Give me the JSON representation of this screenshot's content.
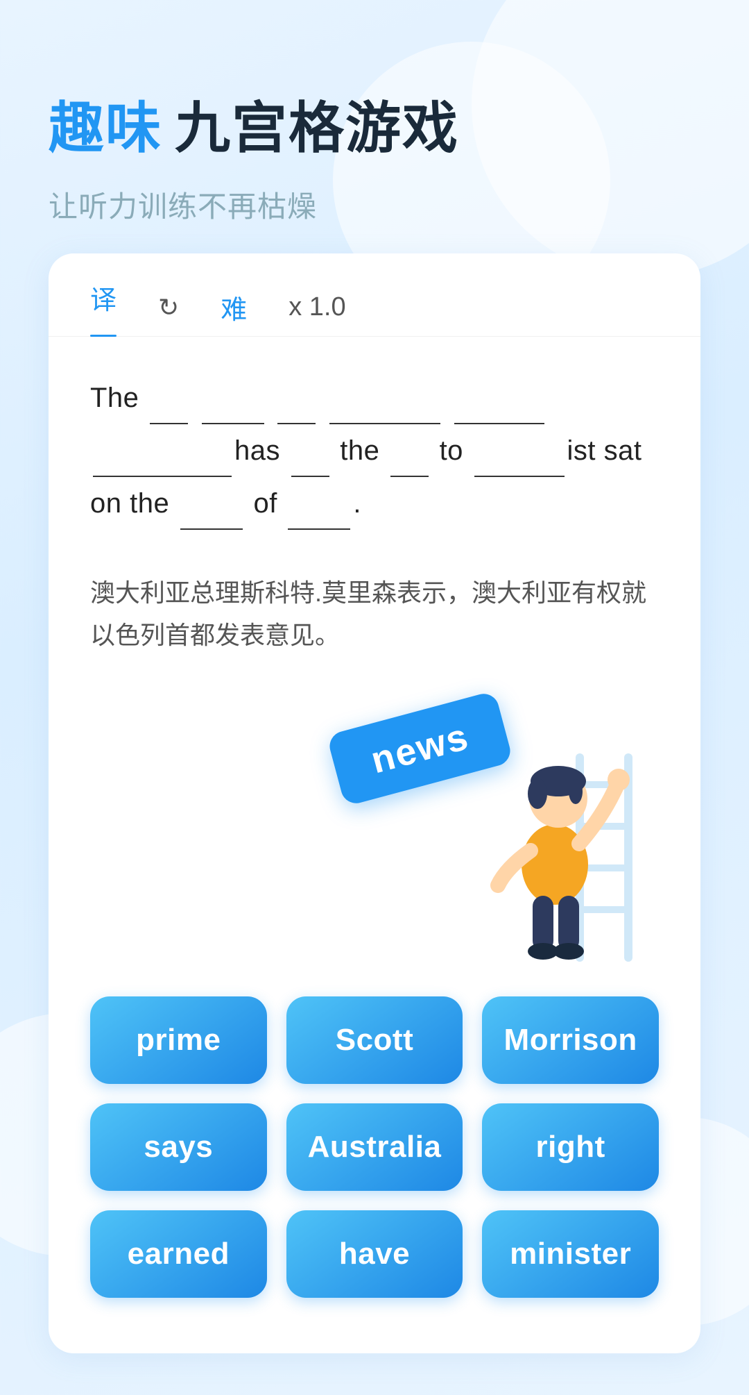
{
  "header": {
    "title_blue": "趣味",
    "title_dark": "九宫格游戏",
    "subtitle": "让听力训练不再枯燥"
  },
  "tabs": [
    {
      "id": "translate",
      "label": "译",
      "active": true
    },
    {
      "id": "refresh",
      "label": "↻",
      "active": false
    },
    {
      "id": "hard",
      "label": "难",
      "active": false
    },
    {
      "id": "speed",
      "label": "x 1.0",
      "active": false
    }
  ],
  "sentence": {
    "line1": "The ___ ______ ___ _________ _____",
    "line2": "________ has ___ the ___ to _____ ist",
    "line3": "sat on the _____ of _____.",
    "display": "The ___ ______ ___ _________ __________ has ___ the ___ to ______ist sat on the _____ of _____."
  },
  "translation": "澳大利亚总理斯科特.莫里森表示，澳大利亚有权就以色列首都发表意见。",
  "floating_word": "news",
  "words": [
    {
      "id": "prime",
      "label": "prime"
    },
    {
      "id": "scott",
      "label": "Scott"
    },
    {
      "id": "morrison",
      "label": "Morrison"
    },
    {
      "id": "says",
      "label": "says"
    },
    {
      "id": "australia",
      "label": "Australia"
    },
    {
      "id": "right",
      "label": "right"
    },
    {
      "id": "earned",
      "label": "earned"
    },
    {
      "id": "have",
      "label": "have"
    },
    {
      "id": "minister",
      "label": "minister"
    }
  ]
}
